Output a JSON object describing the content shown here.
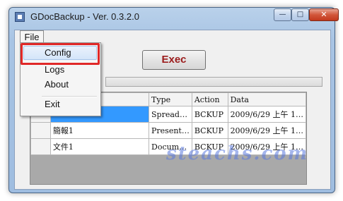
{
  "window": {
    "title": "GDocBackup - Ver. 0.3.2.0",
    "min_glyph": "—",
    "max_glyph": "□",
    "close_glyph": "✕"
  },
  "menu": {
    "file_label": "File",
    "items": [
      "Config",
      "Logs",
      "About",
      "Exit"
    ]
  },
  "toolbar": {
    "exec_label": "Exec"
  },
  "grid": {
    "columns": [
      "",
      "Type",
      "Action",
      "Data"
    ],
    "rows": [
      {
        "name": "",
        "type": "Spread…",
        "action": "BCKUP",
        "data": "2009/6/29 上午 1…"
      },
      {
        "name": "簡報1",
        "type": "Present…",
        "action": "BCKUP",
        "data": "2009/6/29 上午 1…"
      },
      {
        "name": "文件1",
        "type": "Docum…",
        "action": "BCKUP",
        "data": "2009/6/29 上午 1…"
      }
    ]
  },
  "watermark": {
    "text": "steachs.com"
  },
  "colors": {
    "exec_text": "#9b1c1c",
    "selection": "#3399ff",
    "highlight_box": "#e02828"
  }
}
